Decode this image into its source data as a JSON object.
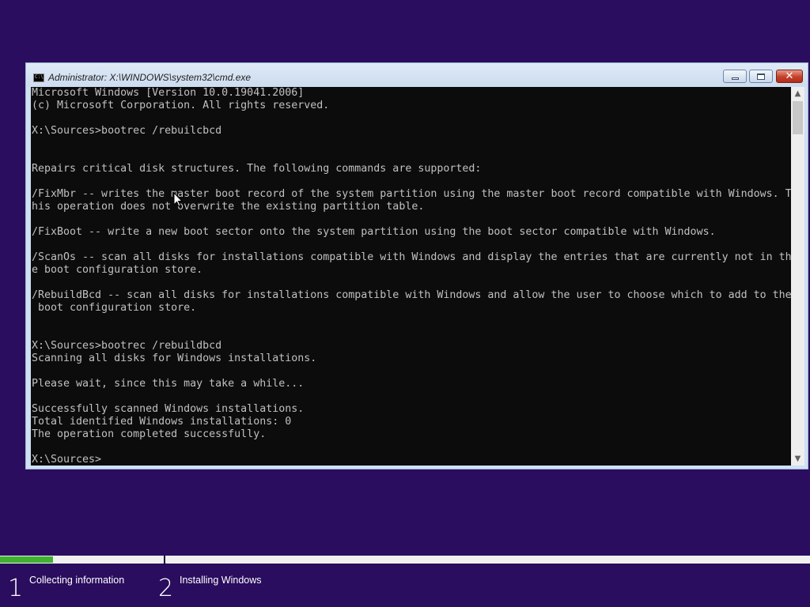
{
  "window": {
    "title": "Administrator: X:\\WINDOWS\\system32\\cmd.exe",
    "icon": "C:\\",
    "buttons": {
      "minimize": "minimize-icon",
      "maximize": "maximize-icon",
      "close": "✕"
    }
  },
  "console": {
    "lines": [
      "Microsoft Windows [Version 10.0.19041.2006]",
      "(c) Microsoft Corporation. All rights reserved.",
      "",
      "X:\\Sources>bootrec /rebuilcbcd",
      "",
      "",
      "Repairs critical disk structures. The following commands are supported:",
      "",
      "/FixMbr -- writes the master boot record of the system partition using the master boot record compatible with Windows. T",
      "his operation does not overwrite the existing partition table.",
      "",
      "/FixBoot -- write a new boot sector onto the system partition using the boot sector compatible with Windows.",
      "",
      "/ScanOs -- scan all disks for installations compatible with Windows and display the entries that are currently not in th",
      "e boot configuration store.",
      "",
      "/RebuildBcd -- scan all disks for installations compatible with Windows and allow the user to choose which to add to the",
      " boot configuration store.",
      "",
      "",
      "X:\\Sources>bootrec /rebuildbcd",
      "Scanning all disks for Windows installations.",
      "",
      "Please wait, since this may take a while...",
      "",
      "Successfully scanned Windows installations.",
      "Total identified Windows installations: 0",
      "The operation completed successfully.",
      "",
      "X:\\Sources>"
    ]
  },
  "scrollbar": {
    "up": "▲",
    "down": "▼"
  },
  "setup": {
    "progress_fraction": 0.065,
    "steps": [
      {
        "number": "1",
        "label": "Collecting information"
      },
      {
        "number": "2",
        "label": "Installing Windows"
      }
    ]
  },
  "colors": {
    "desktop": "#2a0d5e",
    "console_bg": "#0c0c0c",
    "console_fg": "#c0c0c0",
    "progress": "#3fb22f"
  }
}
